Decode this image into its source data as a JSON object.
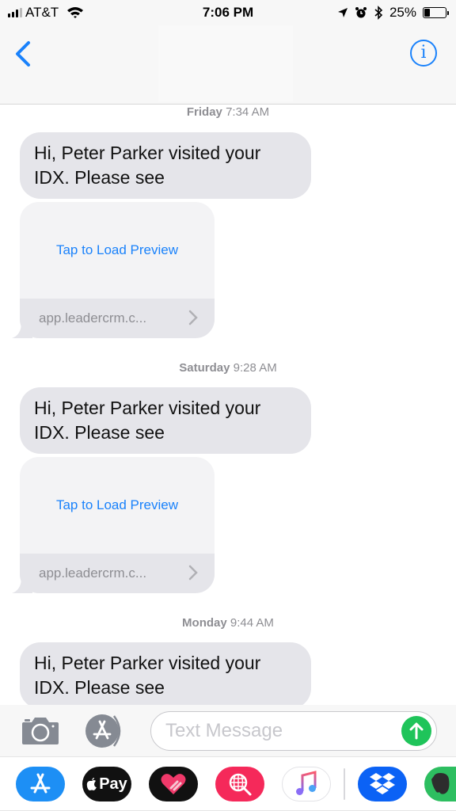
{
  "status_bar": {
    "carrier": "AT&T",
    "time": "7:06 PM",
    "battery_percent_label": "25%",
    "battery_level": 0.25,
    "icons": [
      "signal-icon",
      "wifi-icon",
      "location-icon",
      "alarm-icon",
      "bluetooth-icon",
      "battery-icon"
    ]
  },
  "nav": {
    "back_icon": "chevron-left-icon",
    "info_icon": "info-icon",
    "info_glyph": "i",
    "accent_color": "#1a82fb"
  },
  "messages": [
    {
      "timestamp_day": "Friday",
      "timestamp_time": "7:34 AM",
      "text": "Hi, Peter Parker visited your IDX. Please see",
      "link_preview": {
        "action": "Tap to Load Preview",
        "domain": "app.leadercrm.c..."
      }
    },
    {
      "timestamp_day": "Saturday",
      "timestamp_time": "9:28 AM",
      "text": "Hi, Peter Parker visited your IDX. Please see",
      "link_preview": {
        "action": "Tap to Load Preview",
        "domain": "app.leadercrm.c..."
      }
    },
    {
      "timestamp_day": "Monday",
      "timestamp_time": "9:44 AM",
      "text": "Hi, Peter Parker visited your IDX. Please see"
    }
  ],
  "input_bar": {
    "placeholder": "Text Message",
    "value": "",
    "camera_icon": "camera-icon",
    "apps_icon": "app-store-icon",
    "send_icon": "send-arrow-icon",
    "send_color": "#1fc45a"
  },
  "app_drawer": {
    "apps": [
      {
        "name": "App Store",
        "icon": "app-store-icon",
        "color": "#1d8ff5"
      },
      {
        "name": "Apple Pay",
        "icon": "apple-pay-icon",
        "label": "Pay",
        "color": "#111111"
      },
      {
        "name": "Digital Touch",
        "icon": "heart-icon",
        "color": "#111111"
      },
      {
        "name": "Images Search",
        "icon": "globe-search-icon",
        "color": "#f5295a"
      },
      {
        "name": "Music",
        "icon": "music-note-icon",
        "color": "#ffffff"
      },
      {
        "name": "Dropbox",
        "icon": "dropbox-icon",
        "color": "#0b62f5"
      },
      {
        "name": "Evernote",
        "icon": "evernote-icon",
        "color": "#2dbe60"
      }
    ]
  }
}
